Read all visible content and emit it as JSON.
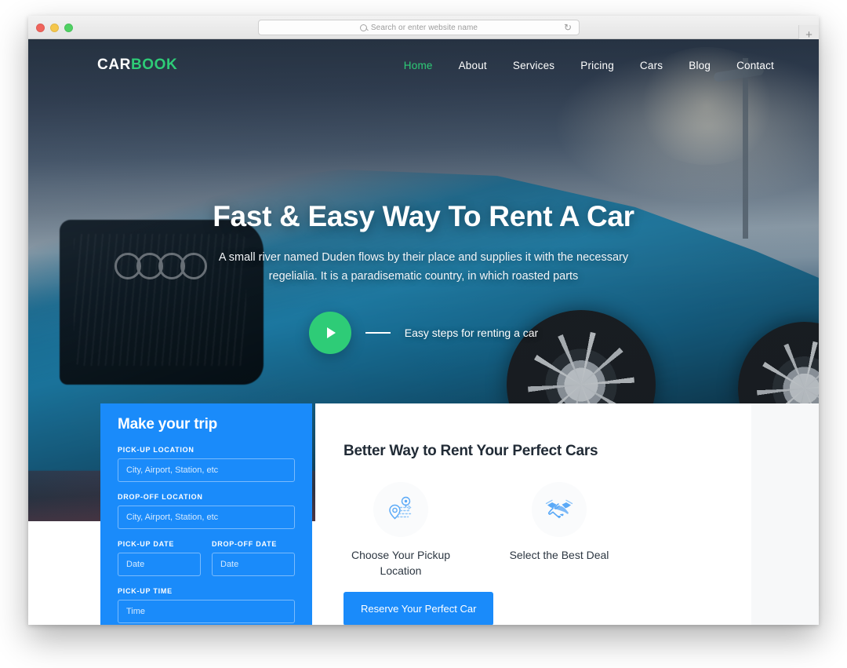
{
  "browser": {
    "traffic_lights": [
      "close",
      "minimize",
      "zoom"
    ],
    "url_placeholder": "Search or enter website name",
    "reload_icon": "reload-icon",
    "search_icon": "search-icon",
    "new_tab_label": "+"
  },
  "site": {
    "logo": {
      "primary": "CAR",
      "accent": "BOOK"
    },
    "nav": [
      {
        "label": "Home",
        "active": true
      },
      {
        "label": "About",
        "active": false
      },
      {
        "label": "Services",
        "active": false
      },
      {
        "label": "Pricing",
        "active": false
      },
      {
        "label": "Cars",
        "active": false
      },
      {
        "label": "Blog",
        "active": false
      },
      {
        "label": "Contact",
        "active": false
      }
    ],
    "hero": {
      "title": "Fast & Easy Way To Rent A Car",
      "subtitle": "A small river named Duden flows by their place and supplies it with the necessary regelialia. It is a paradisematic country, in which roasted parts",
      "play_icon": "play-icon",
      "play_label": "Easy steps for renting a car"
    },
    "booking": {
      "title": "Make your trip",
      "fields": [
        {
          "label": "PICK-UP LOCATION",
          "placeholder": "City, Airport, Station, etc",
          "value": ""
        },
        {
          "label": "DROP-OFF LOCATION",
          "placeholder": "City, Airport, Station, etc",
          "value": ""
        },
        {
          "label": "PICK-UP DATE",
          "placeholder": "Date",
          "value": ""
        },
        {
          "label": "DROP-OFF DATE",
          "placeholder": "Date",
          "value": ""
        },
        {
          "label": "PICK-UP TIME",
          "placeholder": "Time",
          "value": ""
        }
      ]
    },
    "content": {
      "title": "Better Way to Rent Your Perfect Cars",
      "features": [
        {
          "icon": "pickup-location-route-icon",
          "label": "Choose Your Pickup Location"
        },
        {
          "icon": "handshake-deal-icon",
          "label": "Select the Best Deal"
        }
      ],
      "cta_label": "Reserve Your Perfect Car"
    }
  },
  "colors": {
    "brand_green": "#2ecc77",
    "brand_blue": "#1a8bfa",
    "text_dark": "#212b36",
    "white": "#ffffff"
  }
}
